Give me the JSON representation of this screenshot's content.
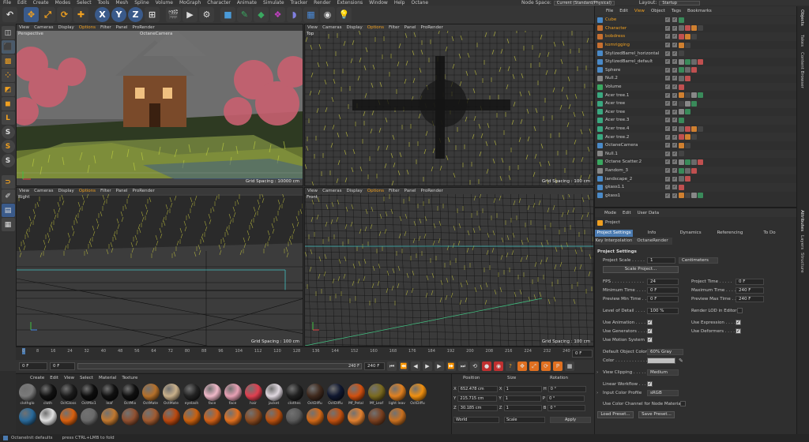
{
  "menubar": [
    "File",
    "Edit",
    "Create",
    "Modes",
    "Select",
    "Tools",
    "Mesh",
    "Spline",
    "Volume",
    "MoGraph",
    "Character",
    "Animate",
    "Simulate",
    "Tracker",
    "Render",
    "Extensions",
    "Window",
    "Help",
    "Octane"
  ],
  "node_space": {
    "label": "Node Space:",
    "value": "Current (Standard/Physical)",
    "layout_label": "Layout:",
    "layout_value": "Startup"
  },
  "toolbar_icons": [
    "undo-icon",
    "move-icon",
    "scale-icon",
    "rotate-icon",
    "move-tool-icon",
    "x-axis-icon",
    "y-axis-icon",
    "z-axis-icon",
    "coordinate-system-icon",
    "render-view-icon",
    "render-picture-icon",
    "render-settings-icon",
    "cube-icon",
    "pen-icon",
    "subdivision-icon",
    "cloner-icon",
    "deformer-icon",
    "environment-icon",
    "camera-icon",
    "light-icon"
  ],
  "viewports": [
    {
      "label": "Perspective",
      "camera": "OctaneCamera",
      "grid": "Grid Spacing : 10000 cm",
      "menu": [
        "View",
        "Cameras",
        "Display",
        "Options",
        "Filter",
        "Panel",
        "ProRender"
      ]
    },
    {
      "label": "Top",
      "camera": "",
      "grid": "Grid Spacing : 100 cm",
      "menu": [
        "View",
        "Cameras",
        "Display",
        "Options",
        "Filter",
        "Panel",
        "ProRender"
      ]
    },
    {
      "label": "Right",
      "camera": "",
      "grid": "Grid Spacing : 100 cm",
      "menu": [
        "View",
        "Cameras",
        "Display",
        "Options",
        "Filter",
        "Panel",
        "ProRender"
      ]
    },
    {
      "label": "Front",
      "camera": "",
      "grid": "Grid Spacing : 100 cm",
      "menu": [
        "View",
        "Cameras",
        "Display",
        "Options",
        "Filter",
        "Panel",
        "ProRender"
      ]
    }
  ],
  "timeline": {
    "ticks": [
      "0",
      "8",
      "16",
      "24",
      "32",
      "40",
      "48",
      "56",
      "64",
      "72",
      "80",
      "88",
      "96",
      "104",
      "112",
      "120",
      "128",
      "136",
      "144",
      "152",
      "160",
      "168",
      "176",
      "184",
      "192",
      "200",
      "208",
      "216",
      "224",
      "232",
      "240"
    ],
    "end_label": "0 F",
    "current_frame": "0 F",
    "start_field": "0 F",
    "end_field": "240 F",
    "end_field2": "240 F"
  },
  "material_manager": {
    "menu": [
      "Create",
      "Edit",
      "View",
      "Select",
      "Material",
      "Texture"
    ],
    "materials": [
      {
        "name": "clothglo",
        "color": "#7a7a7a"
      },
      {
        "name": "cloth",
        "color": "#111111"
      },
      {
        "name": "OctGloss",
        "color": "#1a1a1a"
      },
      {
        "name": "OctMix1",
        "color": "#0d0d0d"
      },
      {
        "name": "leaf",
        "color": "#101010"
      },
      {
        "name": "OctMix",
        "color": "#0f0f0f"
      },
      {
        "name": "OctMate",
        "color": "#b5702a"
      },
      {
        "name": "OctMate",
        "color": "#c9b08a"
      },
      {
        "name": "eyelash",
        "color": "#222222"
      },
      {
        "name": "face",
        "color": "#f0b8c8"
      },
      {
        "name": "face",
        "color": "#e8a0b4"
      },
      {
        "name": "hair",
        "color": "#e04050"
      },
      {
        "name": "jacket",
        "color": "#e0d8e0"
      },
      {
        "name": "clothes",
        "color": "#202020"
      },
      {
        "name": "OctDiffu",
        "color": "#402a1e"
      },
      {
        "name": "OctDiffu",
        "color": "#101830"
      },
      {
        "name": "Mf_Petal",
        "color": "#d05010"
      },
      {
        "name": "Mf_Leaf",
        "color": "#7a6a20"
      },
      {
        "name": "light leav",
        "color": "#e08020"
      },
      {
        "name": "OctDiffu",
        "color": "#f09010"
      },
      {
        "name": "",
        "color": "#2a6a9a"
      },
      {
        "name": "",
        "color": "#e0e0e0"
      },
      {
        "name": "",
        "color": "#d86010"
      },
      {
        "name": "",
        "color": "#6a6a6a"
      },
      {
        "name": "",
        "color": "#c07830"
      },
      {
        "name": "",
        "color": "#905030"
      },
      {
        "name": "",
        "color": "#a05a30"
      },
      {
        "name": "",
        "color": "#b84810"
      },
      {
        "name": "",
        "color": "#c86010"
      },
      {
        "name": "",
        "color": "#d06018"
      },
      {
        "name": "",
        "color": "#e07020"
      },
      {
        "name": "",
        "color": "#8a4a20"
      },
      {
        "name": "",
        "color": "#b85010"
      },
      {
        "name": "",
        "color": "#5a5a5a"
      },
      {
        "name": "",
        "color": "#d06818"
      },
      {
        "name": "",
        "color": "#c05010"
      },
      {
        "name": "",
        "color": "#e08030"
      },
      {
        "name": "",
        "color": "#7a4020"
      },
      {
        "name": "",
        "color": "#c87020"
      }
    ]
  },
  "coordinates": {
    "headers": [
      "Position",
      "Size",
      "Rotation"
    ],
    "rows": [
      {
        "axis": "X",
        "pos": "652.478 cm",
        "size_axis": "X",
        "size": "1",
        "rot_axis": "H",
        "rot": "0 °"
      },
      {
        "axis": "Y",
        "pos": "215.715 cm",
        "size_axis": "Y",
        "size": "1",
        "rot_axis": "P",
        "rot": "0 °"
      },
      {
        "axis": "Z",
        "pos": "30.185 cm",
        "size_axis": "Z",
        "size": "1",
        "rot_axis": "B",
        "rot": "0 °"
      }
    ],
    "world": "World",
    "scale": "Scale",
    "apply": "Apply"
  },
  "objects": {
    "menu": [
      "File",
      "Edit",
      "View",
      "Object",
      "Tags",
      "Bookmarks"
    ],
    "items": [
      {
        "name": "Cube",
        "color": "#f0a020",
        "icon": "#4a8ac8"
      },
      {
        "name": "Character",
        "color": "#f0a020",
        "icon": "#c87030"
      },
      {
        "name": "bobdress",
        "color": "#f0a020",
        "icon": "#c87030"
      },
      {
        "name": "komrigging",
        "color": "#f0a020",
        "icon": "#c87030"
      },
      {
        "name": "StylizedBarrel_horizontal",
        "color": "#c8c8c8",
        "icon": "#4a8ac8"
      },
      {
        "name": "StylizedBarrel_default",
        "color": "#c8c8c8",
        "icon": "#4a8ac8"
      },
      {
        "name": "Sphere",
        "color": "#c8c8c8",
        "icon": "#4a8ac8"
      },
      {
        "name": "Null.2",
        "color": "#c8c8c8",
        "icon": "#888888"
      },
      {
        "name": "Volume",
        "color": "#c8c8c8",
        "icon": "#3aa860"
      },
      {
        "name": "Acer tree.1",
        "color": "#c8c8c8",
        "icon": "#3aa880"
      },
      {
        "name": "Acer tree",
        "color": "#c8c8c8",
        "icon": "#3aa880"
      },
      {
        "name": "Acer tree",
        "color": "#c8c8c8",
        "icon": "#3aa880"
      },
      {
        "name": "Acer tree.3",
        "color": "#c8c8c8",
        "icon": "#3aa880"
      },
      {
        "name": "Acer tree.4",
        "color": "#c8c8c8",
        "icon": "#3aa880"
      },
      {
        "name": "Acer tree.2",
        "color": "#c8c8c8",
        "icon": "#3aa880"
      },
      {
        "name": "OctaneCamera",
        "color": "#c8c8c8",
        "icon": "#4a8ac8"
      },
      {
        "name": "Null.1",
        "color": "#c8c8c8",
        "icon": "#888888"
      },
      {
        "name": "Octane Scatter.2",
        "color": "#c8c8c8",
        "icon": "#3aa860"
      },
      {
        "name": "Random_3",
        "color": "#c8c8c8",
        "icon": "#888888"
      },
      {
        "name": "landscape_2",
        "color": "#c8c8c8",
        "icon": "#4a8ac8"
      },
      {
        "name": "gkass1.1",
        "color": "#c8c8c8",
        "icon": "#4a8ac8"
      },
      {
        "name": "gkass1",
        "color": "#c8c8c8",
        "icon": "#4a8ac8"
      }
    ]
  },
  "side_tabs": [
    "Objects",
    "Takes",
    "Content Browser",
    "Attributes",
    "Layers",
    "Structure"
  ],
  "attributes": {
    "menu": [
      "Mode",
      "Edit",
      "User Data"
    ],
    "title": "Project",
    "tabs": [
      "Project Settings",
      "Info",
      "Dynamics",
      "Referencing",
      "To Do",
      "Key Interpolation",
      "OctaneRender"
    ],
    "section": "Project Settings",
    "project_scale_label": "Project Scale . . . . .",
    "project_scale_value": "1",
    "project_scale_unit": "Centimeters",
    "scale_project_btn": "Scale Project...",
    "fps_label": "FPS . . . . . . . . . . . .",
    "fps": "24",
    "project_time_label": "Project Time . . . . .",
    "project_time": "0 F",
    "min_time_label": "Minimum Time . . . .",
    "min_time": "0 F",
    "max_time_label": "Maximum Time . . . .",
    "max_time": "240 F",
    "preview_min_label": "Preview Min Time . .",
    "preview_min": "0 F",
    "preview_max_label": "Preview Max Time . .",
    "preview_max": "240 F",
    "lod_label": "Level of Detail . . . .",
    "lod": "100 %",
    "render_lod_label": "Render LOD in Editor",
    "use_animation": "Use Animation . . . .",
    "use_expression": "Use Expression . . . .",
    "use_generators": "Use Generators . . . .",
    "use_deformers": "Use Deformers . . . .",
    "use_motion": "Use Motion System",
    "default_color_label": "Default Object Color",
    "default_color": "60% Gray",
    "color_label": "Color . . . . . . . . . . . .",
    "color_swatch": "#c0c0c0",
    "view_clipping_label": "View Clipping . . . . .",
    "view_clipping": "Medium",
    "linear_workflow": "Linear Workflow . . .",
    "input_color_label": "Input Color Profile",
    "input_color": "sRGB",
    "use_color_channel": "Use Color Channel for Node Material",
    "load_preset": "Load Preset...",
    "save_preset": "Save Preset..."
  },
  "status": {
    "left": "OctaneInit defaults",
    "right": "press CTRL+LMB to fold"
  },
  "colors": {
    "accent": "#f0a020",
    "blue_tab": "#4a7ab0",
    "orange": "#e07020"
  }
}
